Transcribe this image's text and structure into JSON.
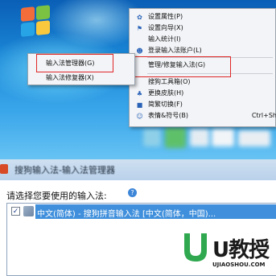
{
  "main_menu": {
    "items": [
      {
        "icon": "gear-icon",
        "label": "设置属性(P)"
      },
      {
        "icon": "flag-icon",
        "label": "设置向导(X)"
      },
      {
        "icon": "",
        "label": "输入统计(I)"
      },
      {
        "icon": "user-icon",
        "label": "登录输入法账户(L)"
      },
      {
        "icon": "",
        "label": "管理/修复输入法(G)"
      },
      {
        "icon": "",
        "label": "搜狗工具箱(O)"
      },
      {
        "icon": "shirt-icon",
        "label": "更换皮肤(H)"
      },
      {
        "icon": "jian-icon",
        "label": "简繁切换(F)"
      },
      {
        "icon": "smiley-icon",
        "label": "表情&符号(B)",
        "shortcut": "Ctrl+Sh"
      }
    ]
  },
  "submenu": {
    "items": [
      "输入法管理器(G)",
      "输入法修复器(X)"
    ]
  },
  "dialog": {
    "title": "搜狗输入法-输入法管理器",
    "prompt": "请选择您要使用的输入法:",
    "list_item": "中文(简体) - 搜狗拼音输入法 [中文(简体，中国)...",
    "checked": true
  },
  "watermark": {
    "brand": "U教授",
    "url": "UJIAOSHOU.COM"
  },
  "colors": {
    "highlight_box": "#e02626",
    "selection": "#3f8fdc",
    "desktop": "#1a86d6"
  }
}
